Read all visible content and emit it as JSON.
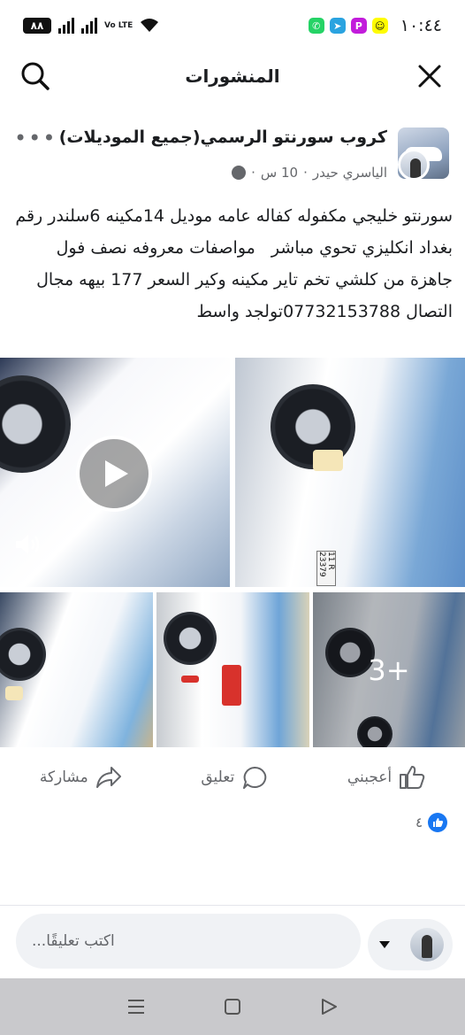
{
  "status_bar": {
    "battery": "٨٨",
    "network": "Vo LTE",
    "time": "١٠:٤٤"
  },
  "header": {
    "title": "المنشورات"
  },
  "post": {
    "group_name": "كروب سورنتو الرسمي(جميع الموديلات)",
    "author": "الياسري حيدر",
    "time_ago": "10 س",
    "separator": "·",
    "text": "سورنتو خليجي مكفوله كفاله عامه موديل 14مكينه 6سلندر رقم بغداد انكليزي تحوي مباشر   مواصفات معروفه نصف فول جاهزة من كلشي تخم تاير مكينه وكير السعر 177 بيهه مجال التصال 07732153788تولجد واسط",
    "plate_text": "11 R 23379",
    "more_photos": "3+",
    "reaction_count": "٤"
  },
  "actions": {
    "like": "أعجبني",
    "comment": "تعليق",
    "share": "مشاركة"
  },
  "comment_box": {
    "placeholder": "اكتب تعليقًا..."
  },
  "colors": {
    "facebook_blue": "#1877f2",
    "secondary_text": "#65676b"
  }
}
